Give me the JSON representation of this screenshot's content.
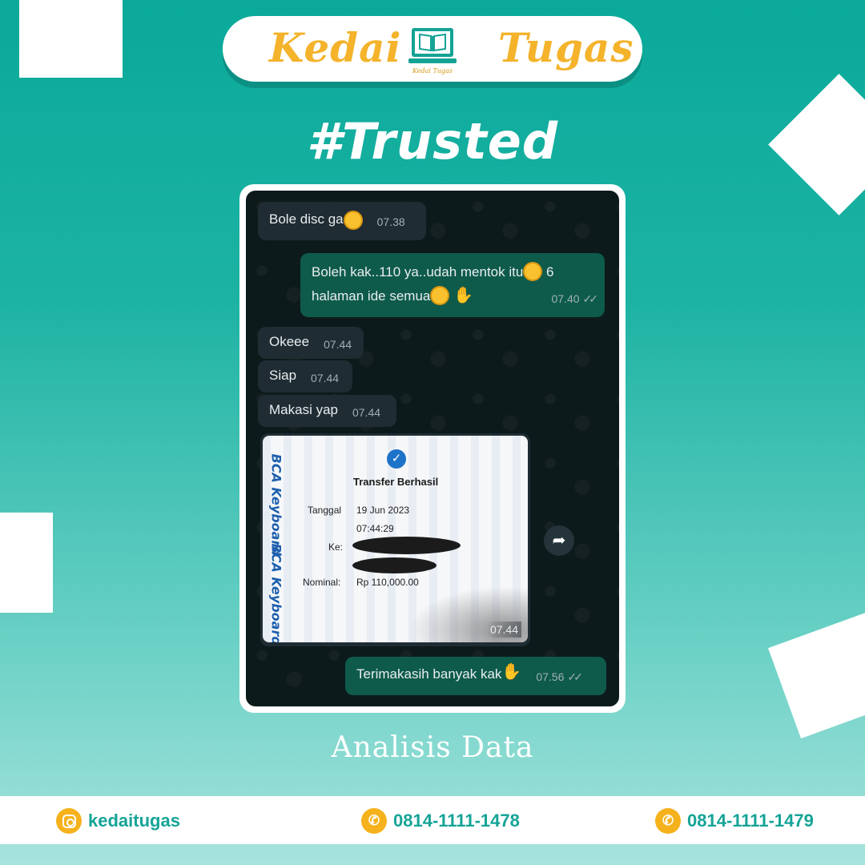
{
  "brand": {
    "left_word": "Kedai",
    "right_word": "Tugas",
    "logo_caption": "Kedai Tugas"
  },
  "hashtag": "#Trusted",
  "chat": {
    "messages": [
      {
        "text": "Bole disc ga",
        "time": "07.38"
      },
      {
        "line1": "Boleh kak..110 ya..udah mentok itu",
        "line1_tail": "6",
        "line2": "halaman ide semua",
        "time": "07.40"
      },
      {
        "text": "Okeee",
        "time": "07.44"
      },
      {
        "text": "Siap",
        "time": "07.44"
      },
      {
        "text": "Makasi yap",
        "time": "07.44"
      },
      {
        "text": "Terimakasih banyak kak",
        "time": "07.56"
      }
    ],
    "receipt": {
      "title": "Transfer Berhasil",
      "tanggal_label": "Tanggal",
      "tanggal_value": "19 Jun 2023",
      "time_value": "07:44:29",
      "ke_label": "Ke:",
      "nominal_label": "Nominal:",
      "nominal_value": "Rp 110,000.00",
      "watermark": "BCA Keyboard",
      "time": "07.44"
    }
  },
  "caption": "Analisis Data",
  "footer": {
    "instagram": "kedaitugas",
    "phone1": "0814-1111-1478",
    "phone2": "0814-1111-1479"
  },
  "colors": {
    "teal": "#0aa99a",
    "gold": "#f4b32b",
    "chat_bg": "#0d1a1b"
  }
}
